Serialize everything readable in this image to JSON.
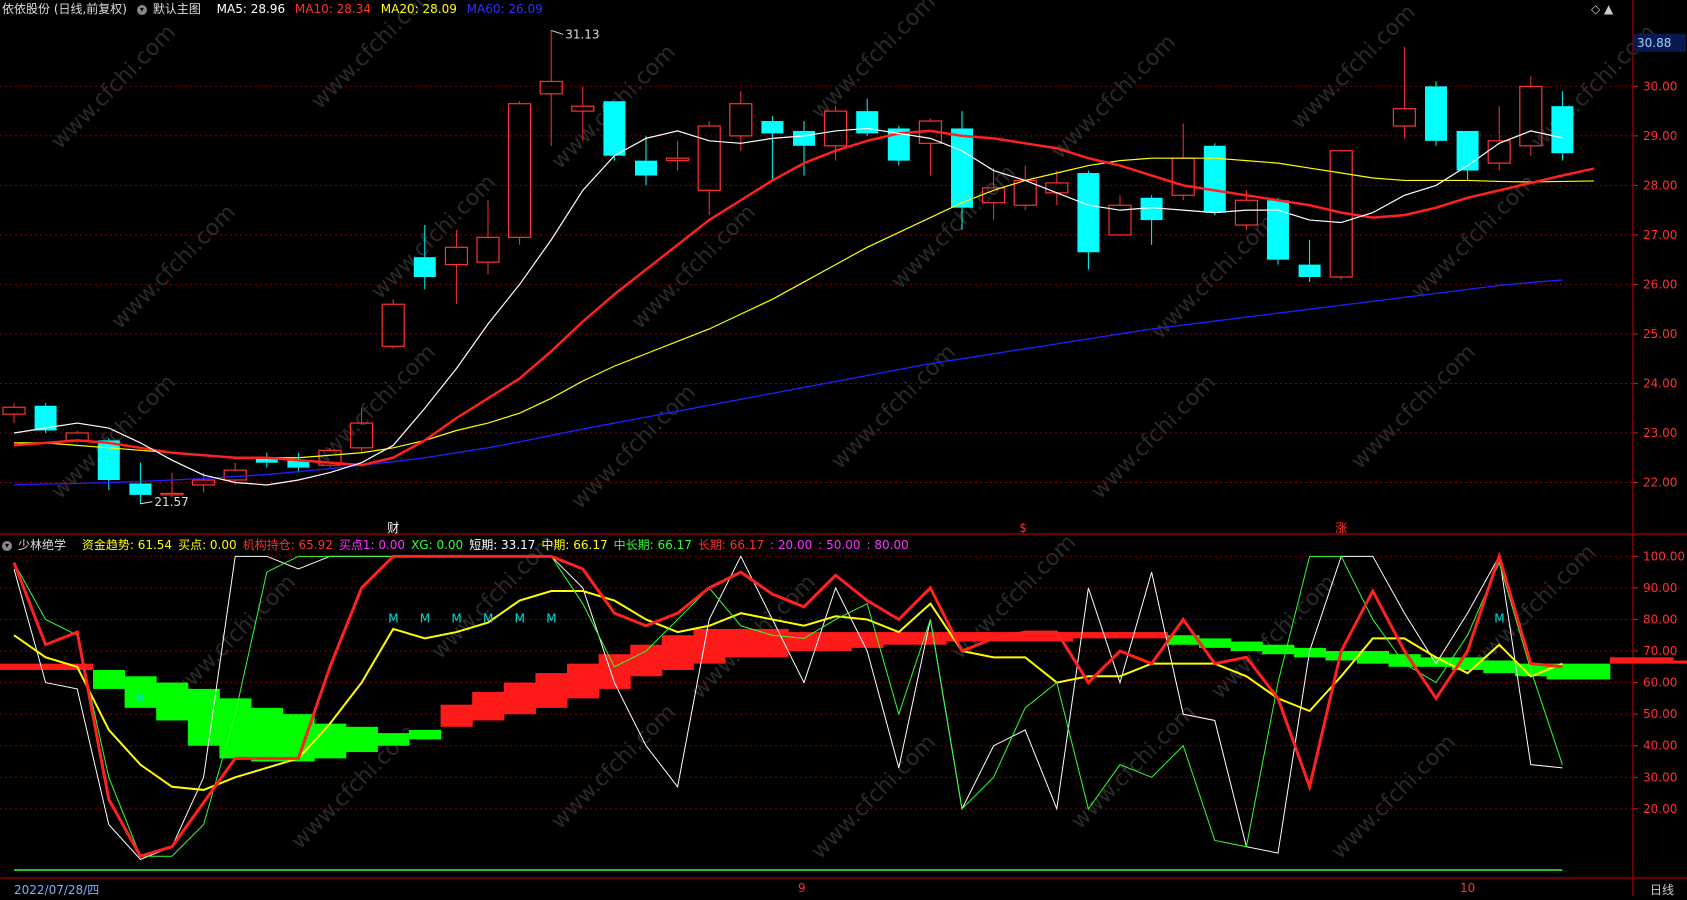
{
  "header": {
    "stock": "依依股份 (日线,前复权)",
    "main_chart": "默认主图",
    "ma5": "MA5: 28.96",
    "ma10": "MA10: 28.34",
    "ma20": "MA20: 28.09",
    "ma60": "MA60: 26.09",
    "top_right_symbols": "◇ ▲"
  },
  "indicator_header": {
    "name": "少林绝学",
    "items": [
      {
        "text": "资金趋势: 61.54",
        "color": "#ffff00"
      },
      {
        "text": "买点: 0.00",
        "color": "#ffff00"
      },
      {
        "text": "机构持仓: 65.92",
        "color": "#ff3030"
      },
      {
        "text": "买点1: 0.00",
        "color": "#ff30ff"
      },
      {
        "text": "XG: 0.00",
        "color": "#30ff30"
      },
      {
        "text": "短期: 33.17",
        "color": "#ffffff"
      },
      {
        "text": "中期: 66.17",
        "color": "#ffff00"
      },
      {
        "text": "中长期: 66.17",
        "color": "#30ff30"
      },
      {
        "text": "长期: 66.17",
        "color": "#ff3030"
      },
      {
        "text": ": 20.00",
        "color": "#ff30ff"
      },
      {
        "text": ": 50.00",
        "color": "#ff30ff"
      },
      {
        "text": ": 80.00",
        "color": "#ff30ff"
      }
    ]
  },
  "bottom_bar": {
    "date": "2022/07/28/四",
    "period": "日线",
    "month_9": "9",
    "month_10": "10"
  },
  "watermark": "www.cfchi.com",
  "colors": {
    "up": "#ff3232",
    "down": "#00ffff",
    "ma5": "#ffffff",
    "ma10": "#ff2020",
    "ma20": "#ffff00",
    "ma60": "#2020ff",
    "grid": "#8b0000"
  },
  "chart_data": [
    {
      "type": "candlestick",
      "ylim": [
        21.0,
        31.3
      ],
      "ytick_values": [
        22.0,
        23.0,
        24.0,
        25.0,
        26.0,
        27.0,
        28.0,
        29.0,
        30.0
      ],
      "yticks": [
        "22.00",
        "23.00",
        "24.00",
        "25.00",
        "26.00",
        "27.00",
        "28.00",
        "29.00",
        "30.00"
      ],
      "current_price_label": "30.88",
      "current_price": 30.88,
      "high_label": "31.13",
      "high_value": 31.13,
      "low_label": "21.57",
      "low_value": 21.57,
      "event_markers": [
        "财",
        "$",
        "涨"
      ],
      "candles": [
        {
          "o": 23.38,
          "c": 23.52,
          "h": 23.6,
          "l": 23.2
        },
        {
          "o": 23.55,
          "c": 23.05,
          "h": 23.6,
          "l": 23.0
        },
        {
          "o": 22.85,
          "c": 23.0,
          "h": 23.05,
          "l": 22.8
        },
        {
          "o": 22.85,
          "c": 22.05,
          "h": 22.9,
          "l": 21.85
        },
        {
          "o": 21.98,
          "c": 21.75,
          "h": 22.4,
          "l": 21.57
        },
        {
          "o": 21.75,
          "c": 21.78,
          "h": 22.2,
          "l": 21.7
        },
        {
          "o": 21.95,
          "c": 22.05,
          "h": 22.2,
          "l": 21.8
        },
        {
          "o": 22.05,
          "c": 22.25,
          "h": 22.4,
          "l": 21.95
        },
        {
          "o": 22.5,
          "c": 22.4,
          "h": 22.6,
          "l": 22.3
        },
        {
          "o": 22.45,
          "c": 22.3,
          "h": 22.6,
          "l": 22.2
        },
        {
          "o": 22.35,
          "c": 22.65,
          "h": 22.7,
          "l": 22.3
        },
        {
          "o": 22.7,
          "c": 23.2,
          "h": 23.5,
          "l": 22.6
        },
        {
          "o": 24.75,
          "c": 25.6,
          "h": 25.7,
          "l": 24.7
        },
        {
          "o": 26.55,
          "c": 26.15,
          "h": 27.2,
          "l": 25.9
        },
        {
          "o": 26.4,
          "c": 26.75,
          "h": 27.1,
          "l": 25.6
        },
        {
          "o": 26.45,
          "c": 26.95,
          "h": 27.7,
          "l": 26.2
        },
        {
          "o": 26.95,
          "c": 29.65,
          "h": 29.7,
          "l": 26.8
        },
        {
          "o": 29.85,
          "c": 30.1,
          "h": 31.13,
          "l": 28.8
        },
        {
          "o": 29.5,
          "c": 29.6,
          "h": 30.0,
          "l": 28.9
        },
        {
          "o": 29.7,
          "c": 28.6,
          "h": 29.7,
          "l": 28.5
        },
        {
          "o": 28.5,
          "c": 28.2,
          "h": 29.0,
          "l": 28.0
        },
        {
          "o": 28.5,
          "c": 28.55,
          "h": 28.9,
          "l": 28.3
        },
        {
          "o": 27.9,
          "c": 29.2,
          "h": 29.3,
          "l": 27.4
        },
        {
          "o": 29.0,
          "c": 29.65,
          "h": 29.9,
          "l": 28.7
        },
        {
          "o": 29.3,
          "c": 29.05,
          "h": 29.4,
          "l": 28.1
        },
        {
          "o": 29.1,
          "c": 28.8,
          "h": 29.3,
          "l": 28.2
        },
        {
          "o": 28.8,
          "c": 29.5,
          "h": 29.6,
          "l": 28.5
        },
        {
          "o": 29.5,
          "c": 29.05,
          "h": 29.75,
          "l": 29.0
        },
        {
          "o": 29.15,
          "c": 28.5,
          "h": 29.2,
          "l": 28.4
        },
        {
          "o": 28.85,
          "c": 29.3,
          "h": 29.35,
          "l": 28.2
        },
        {
          "o": 29.15,
          "c": 27.55,
          "h": 29.5,
          "l": 27.1
        },
        {
          "o": 27.65,
          "c": 27.95,
          "h": 28.35,
          "l": 27.3
        },
        {
          "o": 27.6,
          "c": 28.1,
          "h": 28.4,
          "l": 27.5
        },
        {
          "o": 27.85,
          "c": 28.05,
          "h": 28.3,
          "l": 27.6
        },
        {
          "o": 28.25,
          "c": 26.65,
          "h": 28.3,
          "l": 26.3
        },
        {
          "o": 27.0,
          "c": 27.6,
          "h": 27.8,
          "l": 27.0
        },
        {
          "o": 27.75,
          "c": 27.3,
          "h": 27.8,
          "l": 26.8
        },
        {
          "o": 27.8,
          "c": 28.55,
          "h": 29.25,
          "l": 27.7
        },
        {
          "o": 28.8,
          "c": 27.45,
          "h": 28.85,
          "l": 27.4
        },
        {
          "o": 27.2,
          "c": 27.7,
          "h": 27.9,
          "l": 27.1
        },
        {
          "o": 27.7,
          "c": 26.5,
          "h": 27.75,
          "l": 26.4
        },
        {
          "o": 26.4,
          "c": 26.15,
          "h": 26.9,
          "l": 26.05
        },
        {
          "o": 26.15,
          "c": 28.7,
          "h": 28.7,
          "l": 26.1
        },
        {
          "o": null,
          "c": null,
          "h": null,
          "l": null
        },
        {
          "o": 29.2,
          "c": 29.55,
          "h": 30.8,
          "l": 28.95
        },
        {
          "o": 30.0,
          "c": 28.9,
          "h": 30.1,
          "l": 28.8
        },
        {
          "o": 29.1,
          "c": 28.3,
          "h": 29.1,
          "l": 28.1
        },
        {
          "o": 28.45,
          "c": 28.9,
          "h": 29.6,
          "l": 28.3
        },
        {
          "o": 28.8,
          "c": 30.0,
          "h": 30.2,
          "l": 28.6
        },
        {
          "o": 29.6,
          "c": 28.65,
          "h": 29.9,
          "l": 28.5
        }
      ],
      "ma5": [
        23.0,
        23.1,
        23.2,
        23.1,
        22.8,
        22.45,
        22.15,
        22.0,
        21.95,
        22.05,
        22.2,
        22.4,
        22.75,
        23.5,
        24.3,
        25.2,
        26.0,
        26.9,
        27.9,
        28.6,
        28.95,
        29.1,
        28.9,
        28.85,
        28.95,
        29.0,
        29.1,
        29.15,
        29.05,
        28.95,
        28.7,
        28.3,
        28.1,
        27.85,
        27.6,
        27.5,
        27.55,
        27.5,
        27.45,
        27.5,
        27.5,
        27.3,
        27.25,
        27.45,
        27.8,
        28.0,
        28.4,
        28.85,
        29.1,
        28.96
      ],
      "ma10": [
        22.75,
        22.8,
        22.85,
        22.8,
        22.7,
        22.6,
        22.55,
        22.5,
        22.5,
        22.45,
        22.4,
        22.35,
        22.5,
        22.85,
        23.3,
        23.7,
        24.1,
        24.65,
        25.25,
        25.8,
        26.3,
        26.8,
        27.3,
        27.7,
        28.1,
        28.45,
        28.7,
        28.9,
        29.05,
        29.1,
        29.0,
        28.95,
        28.85,
        28.75,
        28.55,
        28.4,
        28.2,
        28.0,
        27.9,
        27.8,
        27.7,
        27.6,
        27.45,
        27.35,
        27.4,
        27.55,
        27.75,
        27.9,
        28.05,
        28.2,
        28.34
      ],
      "ma20": [
        22.8,
        22.8,
        22.75,
        22.7,
        22.65,
        22.6,
        22.55,
        22.5,
        22.5,
        22.5,
        22.55,
        22.6,
        22.7,
        22.85,
        23.05,
        23.2,
        23.4,
        23.7,
        24.05,
        24.35,
        24.6,
        24.85,
        25.1,
        25.4,
        25.7,
        26.05,
        26.4,
        26.75,
        27.05,
        27.35,
        27.65,
        27.9,
        28.1,
        28.25,
        28.4,
        28.5,
        28.55,
        28.55,
        28.55,
        28.5,
        28.45,
        28.35,
        28.25,
        28.15,
        28.1,
        28.1,
        28.1,
        28.08,
        28.07,
        28.08,
        28.09
      ],
      "ma60": [
        21.95,
        21.97,
        21.98,
        22.0,
        22.02,
        22.05,
        22.08,
        22.12,
        22.16,
        22.22,
        22.28,
        22.35,
        22.42,
        22.5,
        22.6,
        22.7,
        22.82,
        22.95,
        23.08,
        23.2,
        23.32,
        23.44,
        23.56,
        23.68,
        23.8,
        23.92,
        24.04,
        24.16,
        24.28,
        24.4,
        24.5,
        24.6,
        24.7,
        24.8,
        24.9,
        25.0,
        25.1,
        25.18,
        25.26,
        25.34,
        25.42,
        25.5,
        25.58,
        25.66,
        25.74,
        25.82,
        25.9,
        25.98,
        26.04,
        26.09
      ]
    },
    {
      "type": "line",
      "name": "少林绝学",
      "ylim": [
        0,
        102
      ],
      "ytick_values": [
        20,
        30,
        40,
        50,
        60,
        70,
        80,
        90,
        100
      ],
      "yticks": [
        "20.00",
        "30.00",
        "40.00",
        "50.00",
        "60.00",
        "70.00",
        "80.00",
        "90.00",
        "100.00"
      ],
      "m_labels": [
        "M",
        "M",
        "M",
        "M",
        "M",
        "M",
        "M"
      ],
      "m_index": [
        12,
        13,
        14,
        15,
        16,
        17,
        47
      ],
      "m_value": 79,
      "mark_6": "6",
      "series": [
        {
          "name": "短期",
          "color": "#ffffff",
          "values": [
            96,
            60,
            58,
            15,
            4,
            8,
            30,
            100,
            100,
            96,
            100,
            100,
            100,
            100,
            100,
            100,
            100,
            100,
            90,
            60,
            40,
            27,
            80,
            100,
            80,
            60,
            90,
            70,
            33,
            80,
            20,
            40,
            45,
            20,
            90,
            60,
            95,
            50,
            48,
            8,
            6,
            70,
            100,
            100,
            82,
            66,
            82,
            100,
            34,
            33
          ]
        },
        {
          "name": "中期",
          "color": "#ffff00",
          "values": [
            75,
            68,
            65,
            45,
            34,
            27,
            26,
            30,
            33,
            36,
            47,
            60,
            77,
            74,
            76,
            79,
            86,
            89,
            89,
            86,
            80,
            76,
            78,
            82,
            80,
            78,
            81,
            80,
            76,
            85,
            70,
            68,
            68,
            60,
            62,
            62,
            66,
            66,
            66,
            62,
            55,
            51,
            62,
            74,
            74,
            68,
            63,
            72,
            62,
            66
          ]
        },
        {
          "name": "中长期",
          "color": "#30ff30",
          "values": [
            98,
            80,
            75,
            30,
            5,
            5,
            15,
            50,
            95,
            100,
            100,
            100,
            100,
            100,
            100,
            100,
            100,
            100,
            85,
            65,
            70,
            80,
            90,
            78,
            75,
            74,
            80,
            85,
            50,
            80,
            20,
            30,
            52,
            60,
            20,
            34,
            30,
            40,
            10,
            8,
            60,
            100,
            100,
            80,
            66,
            60,
            75,
            98,
            64,
            34
          ]
        },
        {
          "name": "长期",
          "color": "#ff2020",
          "values": [
            98,
            72,
            76,
            23,
            5,
            8,
            22,
            36,
            36,
            36,
            65,
            90,
            100,
            100,
            100,
            100,
            100,
            100,
            96,
            82,
            78,
            82,
            90,
            95,
            88,
            84,
            94,
            86,
            80,
            90,
            70,
            74,
            76,
            76,
            60,
            70,
            66,
            80,
            66,
            68,
            55,
            27,
            70,
            89,
            70,
            55,
            70,
            100,
            66,
            65
          ]
        }
      ],
      "flat_line": {
        "color": "#30ff30",
        "values": [
          66,
          66,
          66,
          66,
          66,
          66,
          66,
          66,
          66,
          66,
          66,
          66,
          66,
          66,
          66,
          66,
          66,
          66,
          66,
          66,
          66,
          66,
          66,
          66,
          66,
          66,
          66,
          66,
          66,
          66,
          66,
          66,
          66,
          66,
          66,
          66,
          66,
          66,
          66,
          66,
          66,
          66,
          66,
          66,
          66,
          66,
          66,
          66,
          66,
          66
        ]
      },
      "blocks": [
        {
          "color": "#ff1a1a",
          "values": [
            [
              64,
              66
            ],
            [
              64,
              66
            ],
            [
              64,
              66
            ]
          ]
        },
        {
          "color": "#00ff00",
          "values": [
            [
              58,
              64
            ],
            [
              52,
              62
            ],
            [
              48,
              60
            ],
            [
              40,
              58
            ],
            [
              36,
              55
            ],
            [
              35,
              52
            ],
            [
              35,
              50
            ],
            [
              36,
              47
            ],
            [
              38,
              46
            ],
            [
              40,
              44
            ],
            [
              42,
              45
            ]
          ]
        },
        {
          "color": "#ff1a1a",
          "values": [
            [
              46,
              53
            ],
            [
              48,
              57
            ],
            [
              50,
              60
            ],
            [
              52,
              63
            ],
            [
              55,
              66
            ],
            [
              58,
              69
            ],
            [
              62,
              72
            ],
            [
              64,
              75
            ],
            [
              66,
              77
            ],
            [
              68,
              77
            ],
            [
              68,
              77
            ],
            [
              70,
              76
            ],
            [
              70,
              76
            ],
            [
              71,
              76
            ],
            [
              72,
              76
            ],
            [
              72,
              76
            ],
            [
              73,
              76
            ],
            [
              73,
              76
            ],
            [
              73,
              76
            ],
            [
              73,
              76
            ],
            [
              74,
              76
            ],
            [
              74,
              76
            ],
            [
              74,
              76
            ]
          ]
        },
        {
          "color": "#00ff00",
          "values": [
            [
              72,
              75
            ],
            [
              71,
              74
            ],
            [
              70,
              73
            ],
            [
              69,
              72
            ],
            [
              68,
              71
            ],
            [
              67,
              70
            ],
            [
              66,
              70
            ],
            [
              65,
              69
            ],
            [
              65,
              68
            ],
            [
              64,
              68
            ],
            [
              63,
              67
            ],
            [
              62,
              66
            ],
            [
              61,
              66
            ],
            [
              61,
              66
            ]
          ]
        },
        {
          "color": "#ff1a1a",
          "values": [
            [
              66,
              68
            ],
            [
              66,
              68
            ],
            [
              66,
              67
            ]
          ]
        },
        {
          "color": "#00ff00",
          "values": [
            [
              65,
              67
            ],
            [
              65,
              67
            ],
            [
              65,
              67
            ]
          ]
        }
      ]
    }
  ]
}
